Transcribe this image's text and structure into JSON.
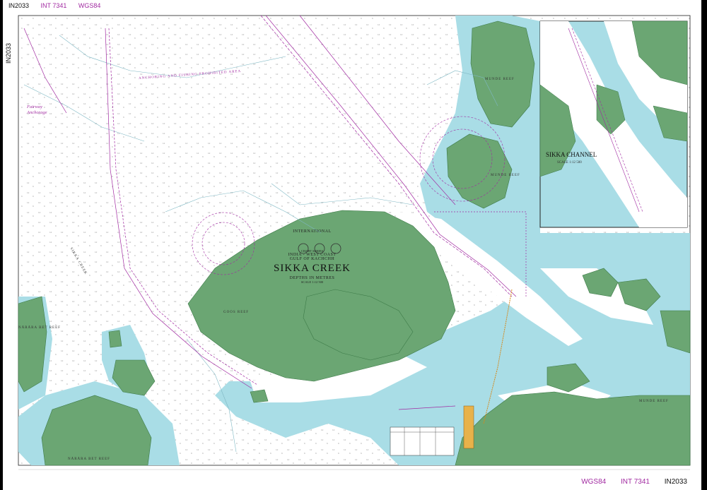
{
  "chart_number": "IN2033",
  "int_number": "INT 7341",
  "datum": "WGS84",
  "title": {
    "header": "INTERNATIONAL",
    "series": "CHART SERIES",
    "region": "INDIA - WEST COAST",
    "gulf": "GULF OF KACHCHH",
    "name": "SIKKA CREEK",
    "depths": "DEPTHS IN METRES",
    "scale": "SCALE 1:12 500"
  },
  "inset": {
    "title": "SIKKA CHANNEL",
    "scale": "SCALE 1:12 500"
  },
  "labels": {
    "anchoring_area": "ANCHORING AND FISHING PROHIBITED AREA",
    "fairway_anchorage": "Fairway\nAnchorage",
    "reef_left": "NĀRĀRA BET REEF",
    "reef_bottom": "NĀRĀRA BET REEF",
    "goos_reef": "GOOS REEF",
    "munde_reef_top": "MUNDE REEF",
    "munde_reef_mid": "MUNDE REEF",
    "munde_reef_right": "MUNDE REEF",
    "sikka_creek_channel": "SIKKA CREEK"
  },
  "colors": {
    "land": "#6ba673",
    "shallow": "#a9dde6",
    "deep": "#ffffff",
    "magenta": "#a12aa1",
    "contour": "#7fb8c4"
  }
}
